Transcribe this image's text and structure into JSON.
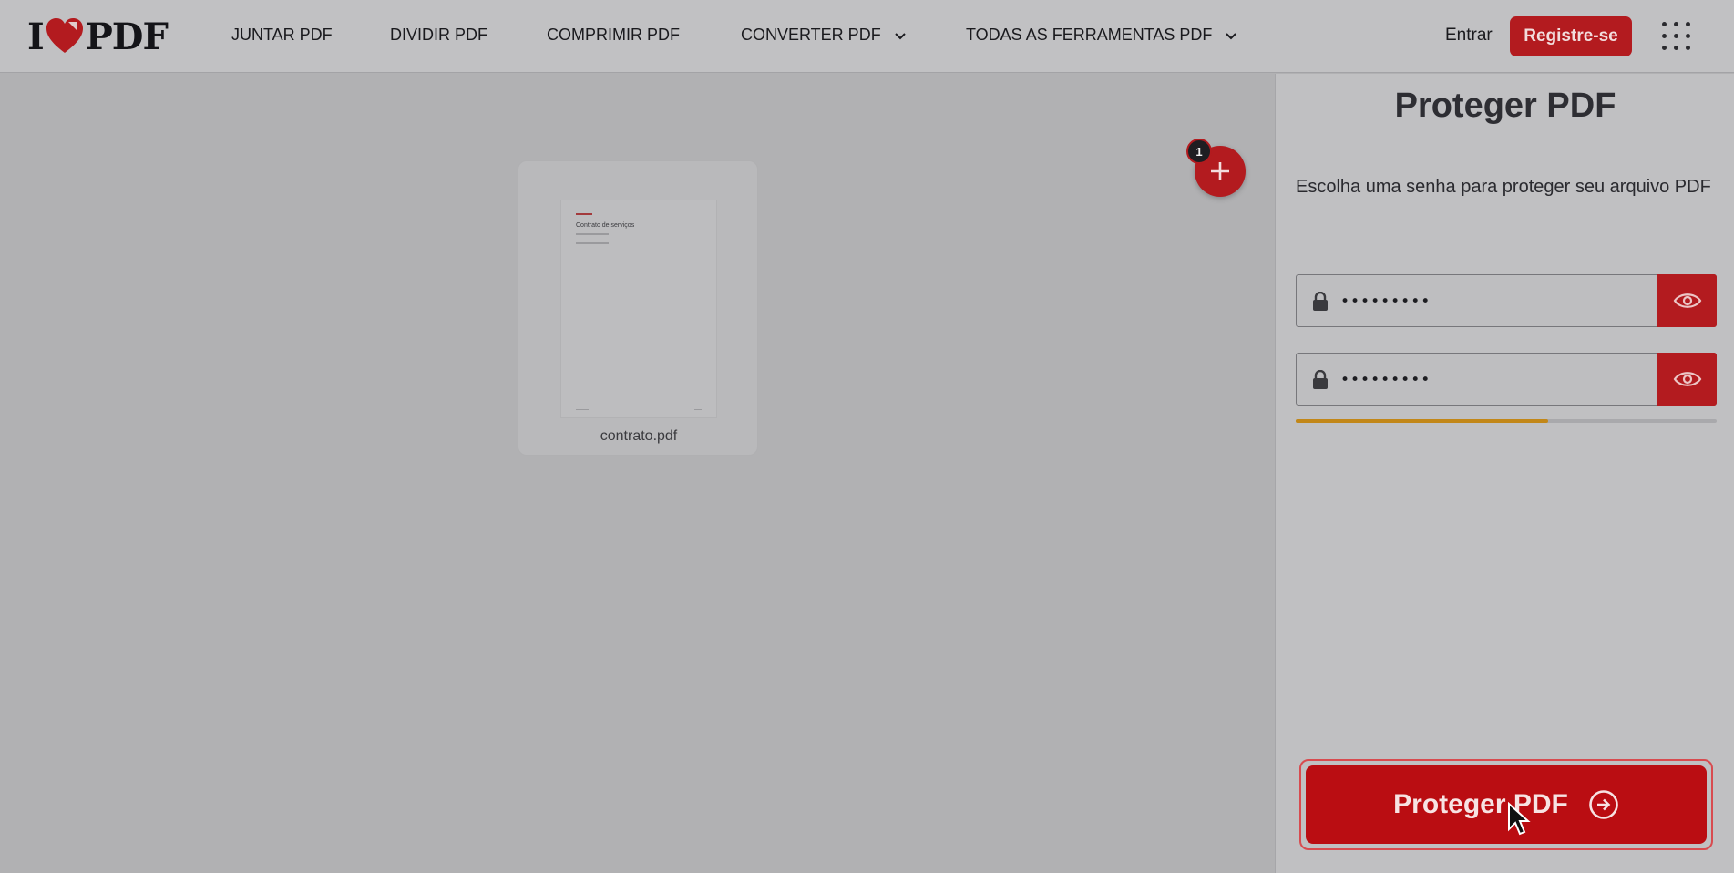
{
  "header": {
    "logo_i": "I",
    "logo_pdf": "PDF",
    "nav": [
      {
        "label": "JUNTAR PDF"
      },
      {
        "label": "DIVIDIR PDF"
      },
      {
        "label": "COMPRIMIR PDF"
      },
      {
        "label": "CONVERTER PDF"
      },
      {
        "label": "TODAS AS FERRAMENTAS PDF"
      }
    ],
    "login_label": "Entrar",
    "signup_label": "Registre-se"
  },
  "workspace": {
    "file": {
      "name": "contrato.pdf",
      "thumb_title": "Contrato de serviços"
    },
    "file_count": "1"
  },
  "sidebar": {
    "title": "Proteger PDF",
    "description": "Escolha uma senha para proteger seu arquivo PDF",
    "password_value": "•••••••••",
    "confirm_value": "•••••••••",
    "strength_fraction": 0.6,
    "submit_label": "Proteger PDF"
  },
  "colors": {
    "brand_red": "#b31b1f",
    "strength": "#c28718"
  }
}
